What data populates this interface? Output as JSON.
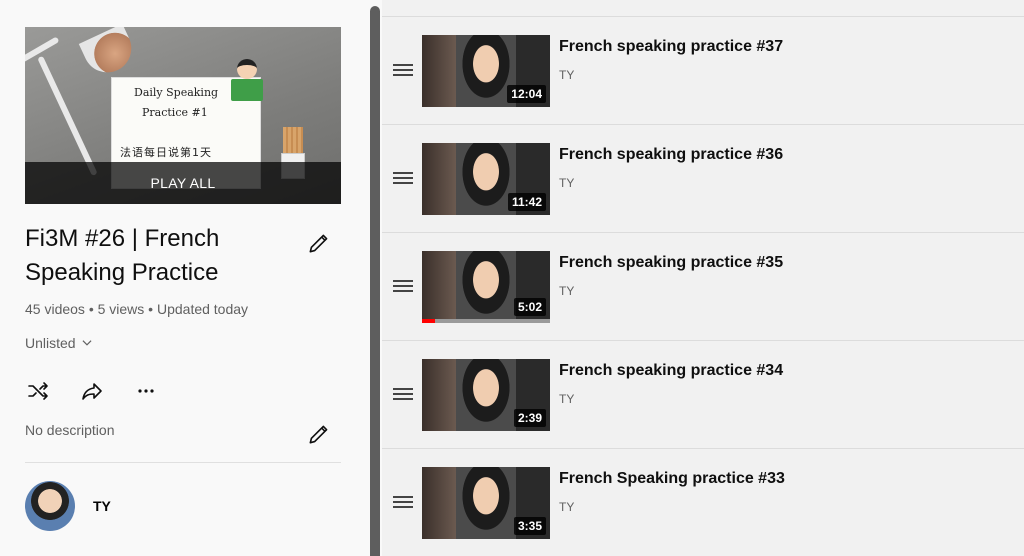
{
  "playlist": {
    "thumbnail": {
      "line1": "Daily Speaking",
      "line2": "Practice #1",
      "line3": "法语每日说第1天",
      "play_all_label": "PLAY ALL"
    },
    "title": "Fi3M #26 | French Speaking Practice",
    "stats": "45 videos • 5 views • Updated today",
    "privacy": "Unlisted",
    "description": "No description",
    "owner": "TY"
  },
  "icons": {
    "edit": "pencil-icon",
    "shuffle": "shuffle-icon",
    "share": "share-icon",
    "more": "more-horizontal-icon",
    "drag": "drag-handle-icon",
    "privacy_dropdown": "chevron-down-icon"
  },
  "videos": [
    {
      "title": "French speaking practice #37",
      "channel": "TY",
      "duration": "12:04"
    },
    {
      "title": "French speaking practice #36",
      "channel": "TY",
      "duration": "11:42"
    },
    {
      "title": "French speaking practice #35",
      "channel": "TY",
      "duration": "5:02",
      "watched_fraction": 0.1
    },
    {
      "title": "French speaking practice #34",
      "channel": "TY",
      "duration": "2:39"
    },
    {
      "title": "French Speaking practice #33",
      "channel": "TY",
      "duration": "3:35"
    }
  ],
  "colors": {
    "progress": "#ff0000",
    "scrollbar": "#5e5e5e",
    "meta_text": "#606060"
  }
}
